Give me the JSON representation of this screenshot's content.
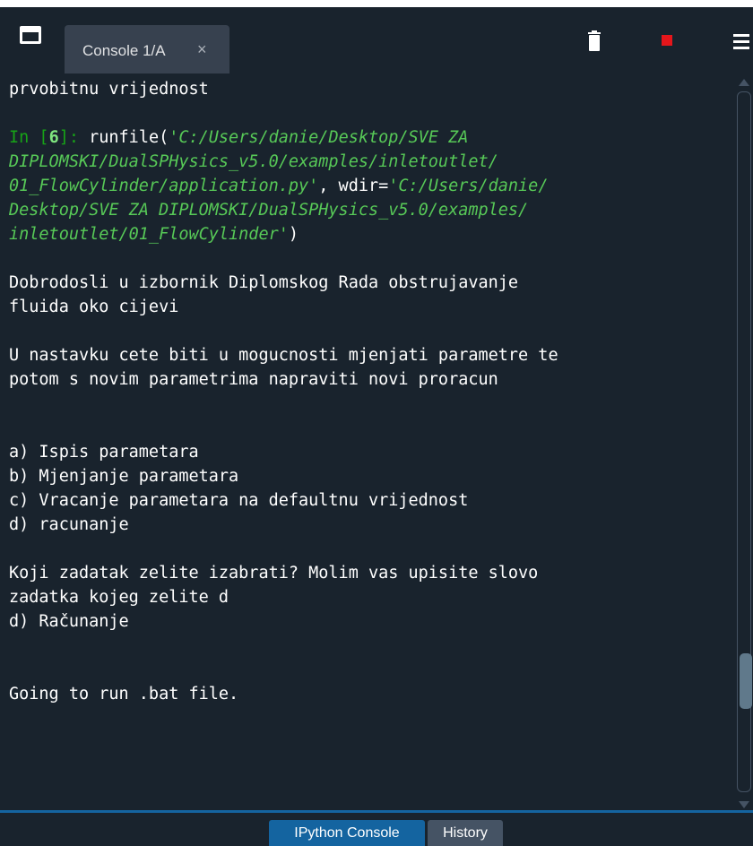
{
  "tabbar": {
    "tab_label": "Console 1/A",
    "close_glyph": "×",
    "icons": [
      "dock-icon",
      "trash-icon",
      "stop-icon",
      "menu-icon"
    ]
  },
  "console": {
    "line_prev": "prvobitnu vrijednost",
    "prompt_in": "In [",
    "prompt_num": "6",
    "prompt_end": "]: ",
    "cmd_runfile": "runfile(",
    "cmd_path": "'C:/Users/danie/Desktop/SVE ZA\nDIPLOMSKI/DualSPHysics_v5.0/examples/inletoutlet/\n01_FlowCylinder/application.py'",
    "cmd_wdir": ", wdir=",
    "cmd_wdir_path": "'C:/Users/danie/\nDesktop/SVE ZA DIPLOMSKI/DualSPHysics_v5.0/examples/\ninletoutlet/01_FlowCylinder'",
    "cmd_close": ")",
    "output": "\nDobrodosli u izbornik Diplomskog Rada obstrujavanje\nfluida oko cijevi\n\nU nastavku cete biti u mogucnosti mjenjati parametre te\npotom s novim parametrima napraviti novi proracun\n\n\na) Ispis parametara\nb) Mjenjanje parametara\nc) Vracanje parametara na defaultnu vrijednost\nd) racunanje\n\nKoji zadatak zelite izabrati? Molim vas upisite slovo\nzadatka kojeg zelite d\nd) Računanje\n\n\nGoing to run .bat file."
  },
  "bottombar": {
    "tab_ipython": "IPython Console",
    "tab_history": "History"
  },
  "colors": {
    "background": "#19232d",
    "accent": "#1464a0",
    "prompt": "#17a317",
    "string": "#57c957",
    "stop": "#e5161b"
  }
}
